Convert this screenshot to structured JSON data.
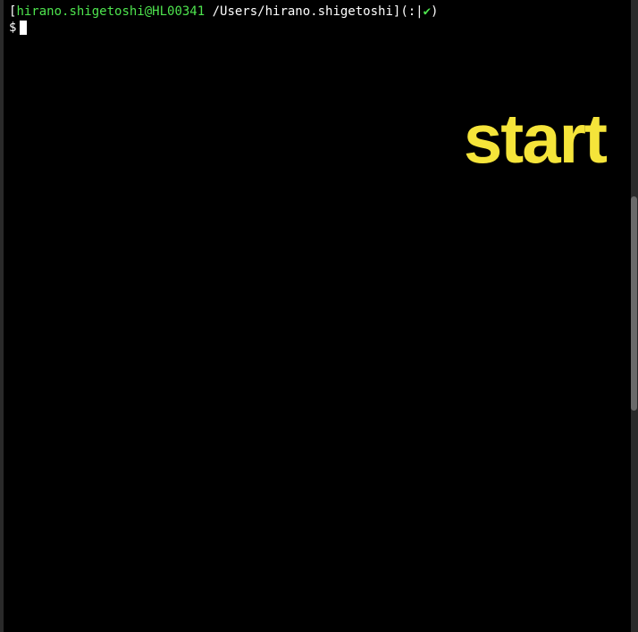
{
  "terminal": {
    "prompt": {
      "bracket_open": "[",
      "user_host": "hirano.shigetoshi@HL00341",
      "path": " /Users/hirano.shigetoshi",
      "bracket_close": "]",
      "paren_open": "(",
      "status": ":|",
      "checkmark": "✔",
      "paren_close": ")"
    },
    "input": {
      "symbol": "$"
    }
  },
  "overlay": {
    "label": "start"
  }
}
